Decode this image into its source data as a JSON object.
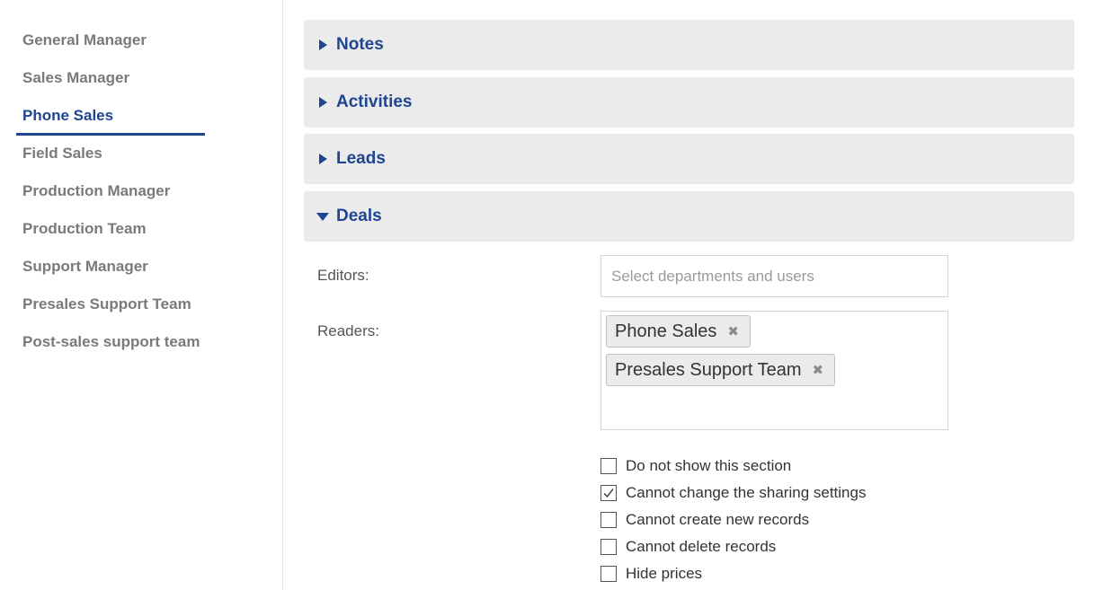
{
  "sidebar": {
    "roles": [
      {
        "label": "General Manager",
        "active": false
      },
      {
        "label": "Sales Manager",
        "active": false
      },
      {
        "label": "Phone Sales",
        "active": true
      },
      {
        "label": "Field Sales",
        "active": false
      },
      {
        "label": "Production Manager",
        "active": false
      },
      {
        "label": "Production Team",
        "active": false
      },
      {
        "label": "Support Manager",
        "active": false
      },
      {
        "label": "Presales Support Team",
        "active": false
      },
      {
        "label": "Post-sales support team",
        "active": false
      }
    ]
  },
  "sections": [
    {
      "title": "Notes",
      "expanded": false
    },
    {
      "title": "Activities",
      "expanded": false
    },
    {
      "title": "Leads",
      "expanded": false
    },
    {
      "title": "Deals",
      "expanded": true
    }
  ],
  "deals": {
    "editors_label": "Editors:",
    "editors_placeholder": "Select departments and users",
    "readers_label": "Readers:",
    "readers": [
      "Phone Sales",
      "Presales Support Team"
    ],
    "tag_remove_glyph": "✖",
    "options": [
      {
        "label": "Do not show this section",
        "checked": false
      },
      {
        "label": "Cannot change the sharing settings",
        "checked": true
      },
      {
        "label": "Cannot create new records",
        "checked": false
      },
      {
        "label": "Cannot delete records",
        "checked": false
      },
      {
        "label": "Hide prices",
        "checked": false
      }
    ]
  },
  "colors": {
    "accent": "#1f4591",
    "muted_text": "#7a7a7a",
    "header_bg": "#ebebeb"
  },
  "icons": {
    "collapsed": "caret-right-icon",
    "expanded": "caret-down-icon",
    "remove": "close-icon",
    "check": "checkmark-icon"
  }
}
